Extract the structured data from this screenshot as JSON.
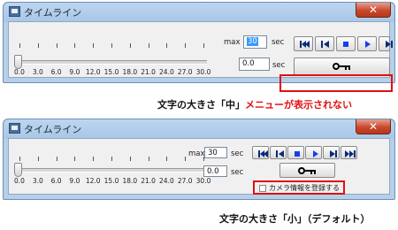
{
  "window_title": "タイムライン",
  "close_label": "✕",
  "slider": {
    "value": 0.0,
    "max": 30.0
  },
  "axis_labels": [
    "0.0",
    "3.0",
    "6.0",
    "9.0",
    "12.0",
    "15.0",
    "18.0",
    "21.0",
    "24.0",
    "27.0",
    "30.0"
  ],
  "max_label": "max",
  "max_value": "30",
  "sec_label": "sec",
  "current_time": "0.0",
  "transport": {
    "first": "skip-to-first-icon",
    "prev": "step-back-icon",
    "stop": "stop-icon",
    "play": "play-icon",
    "next": "step-forward-icon",
    "last": "skip-to-last-icon"
  },
  "key_icon": "key-icon",
  "register_camera_label": "カメラ情報を登録する",
  "caption1": {
    "prefix": "文字の大きさ「中」",
    "note": "メニューが表示されない"
  },
  "caption2": "文字の大きさ「小」（デフォルト）",
  "colors": {
    "highlight": "#e01010",
    "selection": "#3399ff"
  }
}
